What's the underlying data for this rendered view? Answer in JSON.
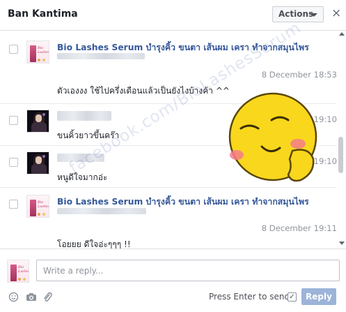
{
  "header": {
    "title": "Ban Kantima",
    "actions_label": "Actions",
    "close_symbol": "×"
  },
  "messages": [
    {
      "sender": "Bio Lashes Serum บำรุงคิ้ว ขนตา เส้นผม เครา ทำจากสมุนไพร",
      "timestamp": "8 December 18:53",
      "text": "ตัวเองงง ใช้ไปครึ่งเดือนแล้วเป็นยังไงบ้างค้า ^^",
      "avatar": "product-logo"
    },
    {
      "sender": "",
      "timestamp": "8 December 19:10",
      "text": "ขนคิ้วยาวขึ้นคร๊า",
      "avatar": "customer-photo"
    },
    {
      "sender": "",
      "timestamp": "19:10",
      "text": "หนูดีใจมากอ่ะ",
      "avatar": "customer-photo"
    },
    {
      "sender": "Bio Lashes Serum บำรุงคิ้ว ขนตา เส้นผม เครา ทำจากสมุนไพร",
      "timestamp": "8 December 19:11",
      "text": "โอยยย ดีใจอ่ะๆๆๆ !!",
      "avatar": "product-logo"
    }
  ],
  "watermark": "facebook.com/BioLashesSerum",
  "composer": {
    "reply_placeholder": "Write a reply...",
    "press_enter_label": "Press Enter to send",
    "press_enter_checked": true,
    "reply_button_label": "Reply"
  },
  "icons": {
    "tools": [
      "emoji-icon",
      "camera-icon",
      "attachment-icon"
    ]
  },
  "colors": {
    "sender_link": "#365899",
    "reply_button_disabled": "#9cb4d8",
    "timestamp": "#90949c",
    "emoji_face": "#f9d71c"
  }
}
